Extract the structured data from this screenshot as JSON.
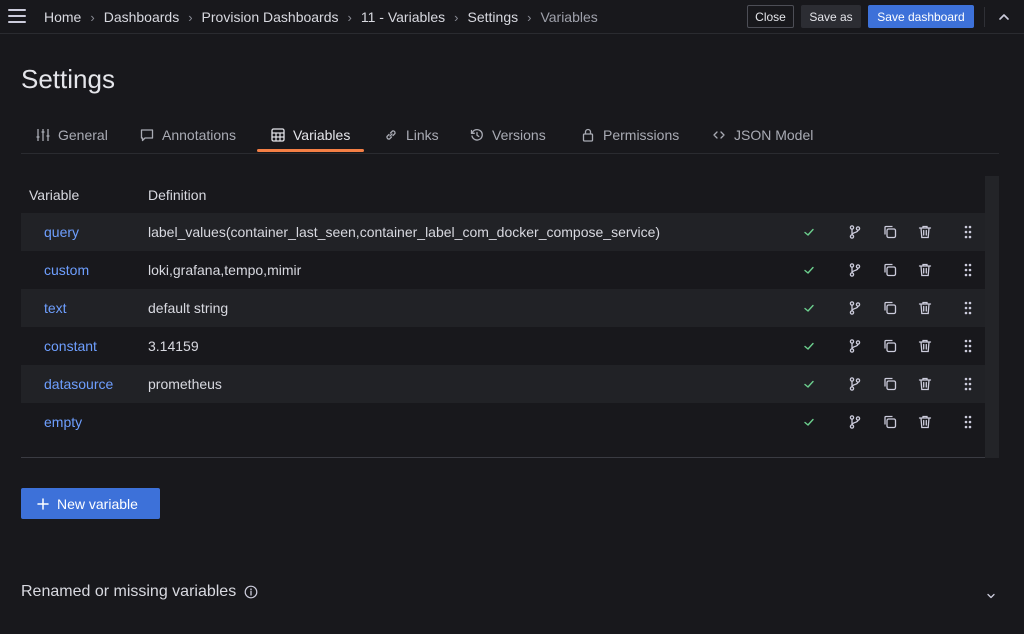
{
  "topbar": {
    "breadcrumbs": [
      {
        "label": "Home"
      },
      {
        "label": "Dashboards"
      },
      {
        "label": "Provision Dashboards"
      },
      {
        "label": "11 - Variables"
      },
      {
        "label": "Settings"
      },
      {
        "label": "Variables"
      }
    ],
    "close_label": "Close",
    "save_as_label": "Save as",
    "save_label": "Save dashboard"
  },
  "page": {
    "title": "Settings"
  },
  "tabs": [
    {
      "label": "General",
      "icon": "sliders-icon"
    },
    {
      "label": "Annotations",
      "icon": "comment-icon"
    },
    {
      "label": "Variables",
      "icon": "calculator-icon",
      "active": true
    },
    {
      "label": "Links",
      "icon": "link-icon"
    },
    {
      "label": "Versions",
      "icon": "history-icon"
    },
    {
      "label": "Permissions",
      "icon": "lock-icon"
    },
    {
      "label": "JSON Model",
      "icon": "code-icon"
    }
  ],
  "table": {
    "headers": {
      "variable": "Variable",
      "definition": "Definition"
    },
    "rows": [
      {
        "name": "query",
        "definition": "label_values(container_last_seen,container_label_com_docker_compose_service)"
      },
      {
        "name": "custom",
        "definition": "loki,grafana,tempo,mimir"
      },
      {
        "name": "text",
        "definition": "default string"
      },
      {
        "name": "constant",
        "definition": "3.14159"
      },
      {
        "name": "datasource",
        "definition": "prometheus"
      },
      {
        "name": "empty",
        "definition": ""
      }
    ]
  },
  "actions": {
    "new_variable_label": "New variable"
  },
  "renamed_section": {
    "title": "Renamed or missing variables"
  },
  "colors": {
    "background": "#18181c",
    "accent_tab": "#f47f45",
    "primary_button": "#3d71d9",
    "link_blue": "#6e9fff",
    "success_green": "#6ccf8e"
  }
}
